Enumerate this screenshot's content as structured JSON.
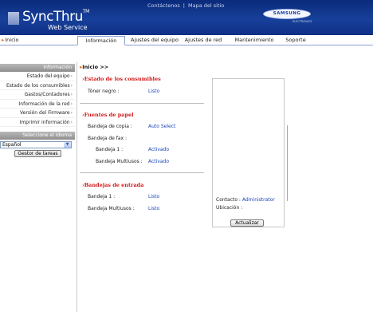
{
  "header": {
    "logo": "SyncThru",
    "logo_tm": "TM",
    "logo_sub": "Web Service",
    "contact_link": "Contáctenos",
    "separator": "|",
    "sitemap_link": "Mapa del sitio",
    "brand": "SAMSUNG",
    "brand_sub": "ELECTRONICS"
  },
  "nav": {
    "home": "Inicio",
    "tabs": [
      "Información",
      "Ajustes del equipo",
      "Ajustes de red",
      "Mantenimiento",
      "Soporte"
    ],
    "active_tab": "Información"
  },
  "sidebar": {
    "heading": "Información",
    "items": [
      "Estado del equipo",
      "Estado de los consumibles",
      "Gastos/Contadores",
      "Información de la red",
      "Versión del Firmware",
      "Imprimir información"
    ],
    "language_heading": "Seleccione el idioma",
    "language_value": "Español",
    "task_manager": "Gestor de tareas"
  },
  "main": {
    "breadcrumb": "Inicio >>",
    "consumables": {
      "title": "Estado de los consumibles",
      "toner_label": "Tóner negro :",
      "toner_value": "Listo"
    },
    "paper_sources": {
      "title": "Fuentes de papel",
      "copy_tray_label": "Bandeja de copia :",
      "copy_tray_value": "Auto Select",
      "fax_tray_label": "Bandeja de fax :",
      "tray1_label": "Bandeja 1 :",
      "tray1_value": "Activado",
      "multi_label": "Bandeja Multiusos :",
      "multi_value": "Activado"
    },
    "input_trays": {
      "title": "Bandejas de entrada",
      "tray1_label": "Bandeja 1 :",
      "tray1_value": "Listo",
      "multi_label": "Bandeja Multiusos :",
      "multi_value": "Listo"
    }
  },
  "panel": {
    "contact_label": "Contacto :",
    "contact_value": "Administrator",
    "location_label": "Ubicación :",
    "update_button": "Actualizar"
  }
}
